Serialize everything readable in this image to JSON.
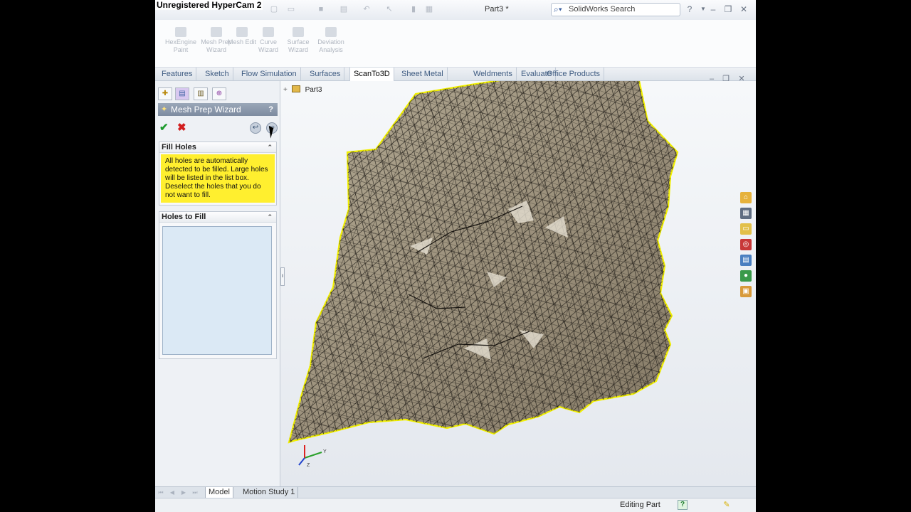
{
  "overlay": {
    "watermark": "Unregistered HyperCam 2"
  },
  "titlebar": {
    "document_title": "Part3 *",
    "search_placeholder": "SolidWorks Search",
    "help_glyph": "?",
    "minimize_glyph": "–",
    "restore_glyph": "❐",
    "close_glyph": "✕"
  },
  "ribbon": {
    "buttons": [
      {
        "label": "HexEngine Paint",
        "icon": "paint-icon"
      },
      {
        "label": "Mesh Prep Wizard",
        "icon": "mesh-wizard-icon"
      },
      {
        "label": "Mesh Edit",
        "icon": "mesh-edit-icon"
      },
      {
        "label": "Curve Wizard",
        "icon": "curve-wizard-icon"
      },
      {
        "label": "Surface Wizard",
        "icon": "surface-wizard-icon"
      },
      {
        "label": "Deviation Analysis",
        "icon": "deviation-icon"
      }
    ]
  },
  "command_tabs": {
    "active": "ScanTo3D",
    "items": [
      "Features",
      "Sketch",
      "Flow Simulation",
      "Surfaces",
      "ScanTo3D",
      "Sheet Metal",
      "Weldments",
      "Evaluate",
      "Office Products"
    ]
  },
  "feature_tree": {
    "root_label": "Part3",
    "expand_glyph": "+"
  },
  "property_manager": {
    "title": "Mesh Prep Wizard",
    "help_glyph": "?",
    "ok_glyph": "✔",
    "cancel_glyph": "✖",
    "back_glyph": "↩",
    "next_glyph": "⇨",
    "groups": {
      "fill_holes": {
        "title": "Fill Holes",
        "message": "All holes are automatically detected to be filled. Large holes will be listed in the list box. Deselect the holes that you do not want to fill."
      },
      "holes_to_fill": {
        "title": "Holes to Fill",
        "items": []
      }
    },
    "collapse_glyph": "⌃"
  },
  "manager_tabs": [
    "feature-manager",
    "property-manager",
    "configuration-manager",
    "dimxpert-manager"
  ],
  "viewport": {
    "triad_axes": [
      "Y",
      "Z"
    ],
    "mesh_color": "#9d927d",
    "edge_color": "#f2f000"
  },
  "task_pane_icons": [
    "home-icon",
    "design-library-icon",
    "file-explorer-icon",
    "search-icon",
    "view-palette-icon",
    "appearances-icon",
    "custom-properties-icon"
  ],
  "bottom_tabs": {
    "items": [
      "Model",
      "Motion Study 1"
    ],
    "active": "Model"
  },
  "statusbar": {
    "status": "Editing Part",
    "help_glyph": "?"
  },
  "colors": {
    "accent": "#3d5a80",
    "help_message_bg": "#ffef2f",
    "listbox_bg": "#dbe9f5"
  }
}
